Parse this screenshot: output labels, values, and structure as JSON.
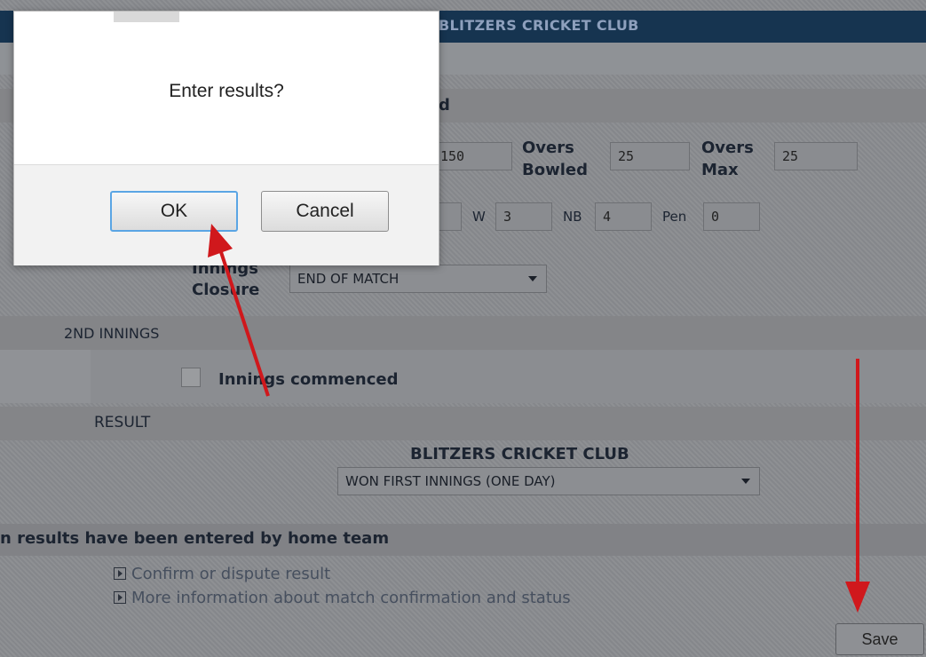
{
  "header": {
    "club_name": "BLITZERS CRICKET CLUB"
  },
  "first_innings": {
    "heading_fragment": "d",
    "runs_value": "150",
    "overs_bowled_label_1": "Overs",
    "overs_bowled_label_2": "Bowled",
    "overs_bowled_value": "25",
    "overs_max_label_1": "Overs",
    "overs_max_label_2": "Max",
    "overs_max_value": "25",
    "w_label": "W",
    "w_value": "3",
    "nb_label": "NB",
    "nb_value": "4",
    "pen_label": "Pen",
    "pen_value": "0",
    "closure_label_1": "Innings",
    "closure_label_2": "Closure",
    "closure_value": "END OF MATCH"
  },
  "second_innings": {
    "heading": "2ND INNINGS",
    "commenced_label": "Innings commenced",
    "commenced_checked": false
  },
  "result": {
    "heading": "RESULT",
    "team_name": "BLITZERS CRICKET CLUB",
    "result_value": "WON FIRST INNINGS (ONE DAY)"
  },
  "status": {
    "message": "n results have been entered by home team",
    "links": [
      "Confirm or dispute result",
      "More information about match confirmation and status"
    ]
  },
  "save_label": "Save",
  "dialog": {
    "message": "Enter results?",
    "ok_label": "OK",
    "cancel_label": "Cancel"
  },
  "colors": {
    "annotation_arrow": "#d0181c",
    "ok_focus": "#5aa5e4"
  }
}
